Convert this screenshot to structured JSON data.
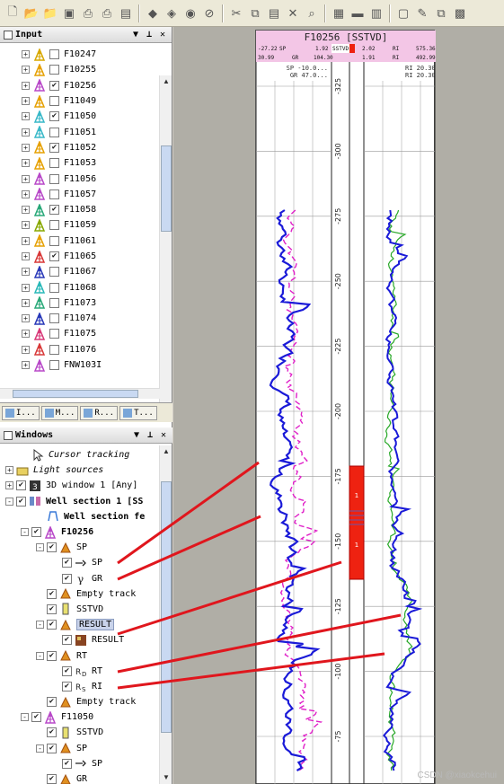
{
  "toolbar": {
    "icons": [
      "new-icon",
      "open-icon",
      "open-folder-icon",
      "save-icon",
      "print-preview-icon",
      "print-icon",
      "save-as-icon",
      "back-icon",
      "forward-icon",
      "zoom-icon",
      "stop-icon",
      "cut-icon",
      "copy-icon",
      "paste-icon",
      "delete-icon",
      "find-icon",
      "properties-icon",
      "folder-icon",
      "chart-icon",
      "frame-icon",
      "edit-icon",
      "window-icon",
      "image-icon"
    ]
  },
  "input_panel": {
    "title": "Input",
    "items": [
      {
        "label": "F10247",
        "color": "#d8a800",
        "checked": false
      },
      {
        "label": "F10255",
        "color": "#e6a000",
        "checked": false
      },
      {
        "label": "F10256",
        "color": "#b848c8",
        "checked": true
      },
      {
        "label": "F11049",
        "color": "#e6a000",
        "checked": false
      },
      {
        "label": "F11050",
        "color": "#38b8c8",
        "checked": true
      },
      {
        "label": "F11051",
        "color": "#38b8c8",
        "checked": false
      },
      {
        "label": "F11052",
        "color": "#e6a000",
        "checked": true
      },
      {
        "label": "F11053",
        "color": "#e6a000",
        "checked": false
      },
      {
        "label": "F11056",
        "color": "#b848c8",
        "checked": false
      },
      {
        "label": "F11057",
        "color": "#b848c8",
        "checked": false
      },
      {
        "label": "F11058",
        "color": "#28a878",
        "checked": true
      },
      {
        "label": "F11059",
        "color": "#88a800",
        "checked": false
      },
      {
        "label": "F11061",
        "color": "#e6a000",
        "checked": false
      },
      {
        "label": "F11065",
        "color": "#d83838",
        "checked": true
      },
      {
        "label": "F11067",
        "color": "#2838b8",
        "checked": false
      },
      {
        "label": "F11068",
        "color": "#28b8b8",
        "checked": false
      },
      {
        "label": "F11073",
        "color": "#28a878",
        "checked": false
      },
      {
        "label": "F11074",
        "color": "#2838b8",
        "checked": false
      },
      {
        "label": "F11075",
        "color": "#d83878",
        "checked": false
      },
      {
        "label": "F11076",
        "color": "#d83838",
        "checked": false
      },
      {
        "label": "FNW103I",
        "color": "#b848c8",
        "checked": false
      }
    ],
    "tabs": [
      "I...",
      "M...",
      "R...",
      "T..."
    ]
  },
  "windows_panel": {
    "title": "Windows",
    "items": [
      {
        "label": "Cursor tracking",
        "level": 1,
        "italic": true,
        "expand": "",
        "check": "",
        "icon": "cursor-icon"
      },
      {
        "label": "Light sources",
        "level": 0,
        "italic": true,
        "expand": "+",
        "check": "",
        "icon": "light-icon"
      },
      {
        "label": "3D window 1 [Any]",
        "level": 0,
        "expand": "+",
        "check": "on",
        "icon": "3d-window-icon"
      },
      {
        "label": "Well section 1 [SS",
        "level": 0,
        "bold": true,
        "expand": "-",
        "check": "on",
        "icon": "well-section-icon"
      },
      {
        "label": "Well section fe",
        "level": 2,
        "bold": true,
        "expand": "",
        "check": "",
        "icon": "fence-icon"
      },
      {
        "label": "F10256",
        "level": 1,
        "bold": true,
        "expand": "-",
        "check": "on",
        "icon": "well-icon"
      },
      {
        "label": "SP",
        "level": 2,
        "expand": "-",
        "check": "on",
        "icon": "track-icon"
      },
      {
        "label": "SP",
        "level": 3,
        "expand": "",
        "check": "on",
        "icon": "log-sp-icon"
      },
      {
        "label": "GR",
        "level": 3,
        "expand": "",
        "check": "on",
        "icon": "log-gr-icon"
      },
      {
        "label": "Empty track",
        "level": 2,
        "expand": "",
        "check": "on",
        "icon": "track-icon"
      },
      {
        "label": "SSTVD",
        "level": 2,
        "expand": "",
        "check": "on",
        "icon": "depth-track-icon"
      },
      {
        "label": "RESULT",
        "level": 2,
        "expand": "-",
        "check": "on",
        "icon": "track-icon",
        "selected": true
      },
      {
        "label": "RESULT",
        "level": 3,
        "expand": "",
        "check": "on",
        "icon": "result-icon"
      },
      {
        "label": "RT",
        "level": 2,
        "expand": "-",
        "check": "on",
        "icon": "track-icon"
      },
      {
        "label": "RT",
        "level": 3,
        "expand": "",
        "check": "on",
        "icon": "log-rt-icon"
      },
      {
        "label": "RI",
        "level": 3,
        "expand": "",
        "check": "on",
        "icon": "log-ri-icon"
      },
      {
        "label": "Empty track",
        "level": 2,
        "expand": "",
        "check": "on",
        "icon": "track-icon"
      },
      {
        "label": "F11050",
        "level": 1,
        "expand": "-",
        "check": "on",
        "icon": "well-icon"
      },
      {
        "label": "SSTVD",
        "level": 2,
        "expand": "",
        "check": "on",
        "icon": "depth-track-icon"
      },
      {
        "label": "SP",
        "level": 2,
        "expand": "-",
        "check": "on",
        "icon": "track-icon"
      },
      {
        "label": "SP",
        "level": 3,
        "expand": "",
        "check": "on",
        "icon": "log-sp-icon"
      },
      {
        "label": "GR",
        "level": 2,
        "expand": "",
        "check": "on",
        "icon": "track-icon"
      }
    ]
  },
  "well_section": {
    "title": "F10256 [SSTVD]",
    "hdr_left1": [
      "-27.22",
      "SP",
      "1.92"
    ],
    "hdr_left2": [
      "30.99",
      "GR",
      "104.30"
    ],
    "hdr_mid": "SSTVD",
    "hdr_right1": [
      "2.02",
      "RI",
      "575.36"
    ],
    "hdr_right2": [
      "1.91",
      "RI",
      "492.99"
    ],
    "scale_left": [
      "SP -10.0...",
      "GR 47.0..."
    ],
    "scale_right": [
      "RI 20.30",
      "RI 20.30"
    ],
    "depth_labels": [
      "-325",
      "-300",
      "-275",
      "-250",
      "-225",
      "-200",
      "-175",
      "-150",
      "-125",
      "-100",
      "-75"
    ],
    "result_labels": [
      "1",
      "1"
    ],
    "colors": {
      "sp": "#1a1ad8",
      "gr": "#e020c8",
      "rt": "#1a1ad8",
      "ri": "#28a828",
      "result": "#ee2211",
      "annotation": "#e0161d"
    }
  },
  "watermark": "CSDN @xiaokcehui"
}
